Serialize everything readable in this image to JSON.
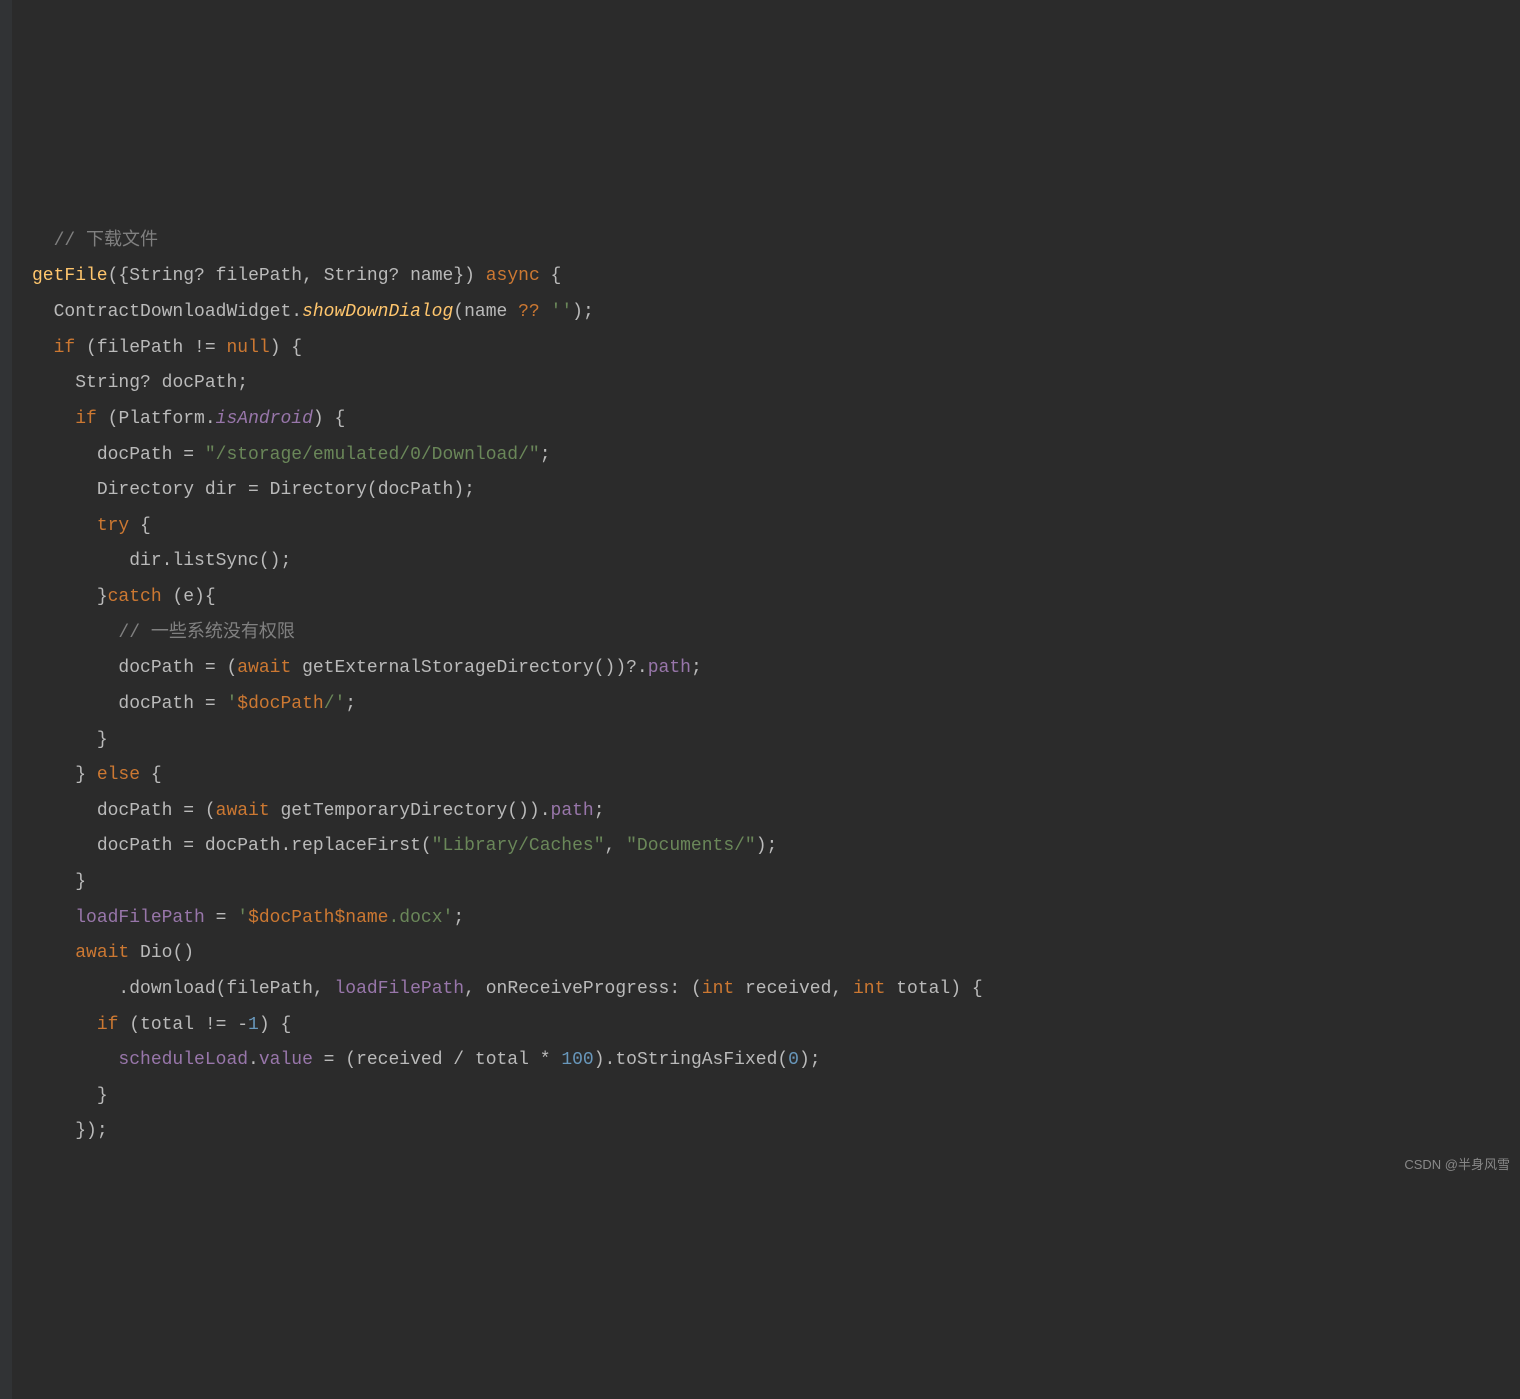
{
  "gutter": {
    "icons": [
      "fold",
      "fold",
      "fold",
      "fold",
      "fold",
      "fold",
      "fold",
      "fold"
    ]
  },
  "code": {
    "l1_comment": "// 下载文件",
    "l2_func": "getFile",
    "l2_params_open": "({",
    "l2_type1": "String",
    "l2_q": "?",
    "l2_p1": " filePath",
    "l2_comma": ", ",
    "l2_type2": "String",
    "l2_p2": " name",
    "l2_params_close": "}) ",
    "l2_async": "async",
    "l2_brace": " {",
    "l3_class": "ContractDownloadWidget",
    "l3_dot": ".",
    "l3_method": "showDownDialog",
    "l3_open": "(",
    "l3_arg": "name ",
    "l3_null_op": "?? ",
    "l3_str": "''",
    "l3_close": ");",
    "l4_if": "if",
    "l4_cond_open": " (",
    "l4_var": "filePath",
    "l4_op": " != ",
    "l4_null": "null",
    "l4_cond_close": ") {",
    "l5_type": "String",
    "l5_q": "?",
    "l5_var": " docPath;",
    "l6_if": "if",
    "l6_open": " (",
    "l6_platform": "Platform",
    "l6_dot": ".",
    "l6_field": "isAndroid",
    "l6_close": ") {",
    "l7_var": "docPath = ",
    "l7_str": "\"/storage/emulated/0/Download/\"",
    "l7_semi": ";",
    "l8_type": "Directory",
    "l8_var": " dir = ",
    "l8_ctor": "Directory",
    "l8_open": "(",
    "l8_arg": "docPath",
    "l8_close": ");",
    "l9_try": "try",
    "l9_brace": " {",
    "l10_call": "dir.listSync();",
    "l11_close": "}",
    "l11_catch": "catch",
    "l11_e": " (e){",
    "l12_comment": "// 一些系统没有权限",
    "l13_var": "docPath = (",
    "l13_await": "await",
    "l13_call": " getExternalStorageDirectory())?.",
    "l13_path": "path",
    "l13_semi": ";",
    "l14_var": "docPath = ",
    "l14_str1": "'",
    "l14_interp": "$docPath",
    "l14_str2": "/'",
    "l14_semi": ";",
    "l15_close": "}",
    "l16_close": "} ",
    "l16_else": "else",
    "l16_brace": " {",
    "l17_var": "docPath = (",
    "l17_await": "await",
    "l17_call": " getTemporaryDirectory()).",
    "l17_path": "path",
    "l17_semi": ";",
    "l18_var": "docPath = docPath.replaceFirst(",
    "l18_str1": "\"Library/Caches\"",
    "l18_comma": ", ",
    "l18_str2": "\"Documents/\"",
    "l18_close": ");",
    "l19_close": "}",
    "l20_var": "loadFilePath",
    "l20_eq": " = ",
    "l20_str1": "'",
    "l20_interp1": "$docPath$name",
    "l20_str2": ".docx'",
    "l20_semi": ";",
    "l21_await": "await",
    "l21_sp": " ",
    "l21_dio": "Dio",
    "l21_call": "()",
    "l22_dot": ".download(",
    "l22_a1": "filePath",
    "l22_c1": ", ",
    "l22_a2": "loadFilePath",
    "l22_c2": ", ",
    "l22_named": "onReceiveProgress",
    "l22_colon": ": (",
    "l22_int1": "int",
    "l22_p1": " received, ",
    "l22_int2": "int",
    "l22_p2": " total) {",
    "l23_if": "if",
    "l23_open": " (total != -",
    "l23_num": "1",
    "l23_close": ") {",
    "l24_var": "scheduleLoad",
    "l24_dot": ".",
    "l24_value": "value",
    "l24_eq": " = (received / total * ",
    "l24_num": "100",
    "l24_call": ").toStringAsFixed(",
    "l24_zero": "0",
    "l24_close": ");",
    "l25_close": "}",
    "l26_close": "});"
  },
  "watermark": "CSDN @半身风雪"
}
